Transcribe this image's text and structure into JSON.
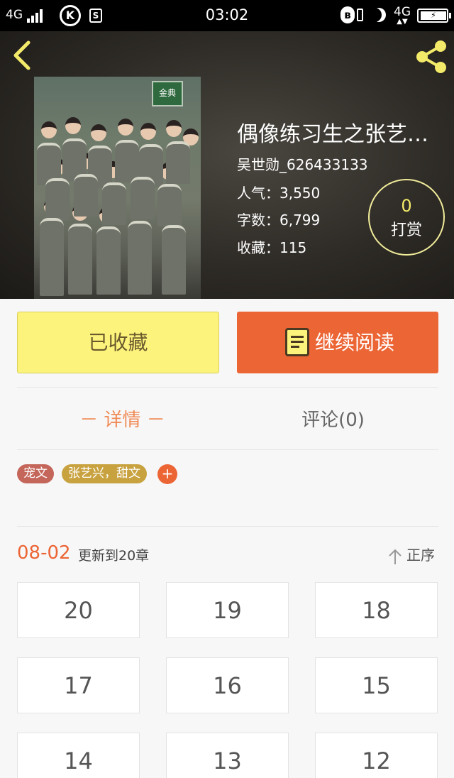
{
  "status_bar": {
    "network": "4G",
    "k_icon": "K",
    "s_icon": "S",
    "time": "03:02",
    "lte": "4G"
  },
  "book": {
    "title": "偶像练习生之张艺…",
    "author": "吴世勋_626433133",
    "popularity": "人气：3,550",
    "word_count": "字数：6,799",
    "favorites": "收藏：115",
    "reward_count": "0",
    "reward_label": "打赏"
  },
  "actions": {
    "favorited_label": "已收藏",
    "continue_label": "继续阅读"
  },
  "tabs": {
    "detail": "－ 详情 －",
    "comments": "评论(0)"
  },
  "tags": [
    "宠文",
    "张艺兴，甜文"
  ],
  "tag_add": "+",
  "chapters": {
    "update_date": "08-02",
    "update_text": "更新到20章",
    "sort_label": "正序",
    "items": [
      "20",
      "19",
      "18",
      "17",
      "16",
      "15",
      "14",
      "13",
      "12"
    ]
  },
  "colors": {
    "accent_orange": "#ec6535",
    "accent_yellow": "#fcf37c",
    "tag_red": "#c4665a",
    "tag_gold": "#c9a240"
  },
  "icons": [
    "back-arrow-icon",
    "share-icon",
    "book-icon",
    "sort-arrow-icon",
    "bluetooth-icon",
    "moon-icon",
    "battery-icon"
  ]
}
